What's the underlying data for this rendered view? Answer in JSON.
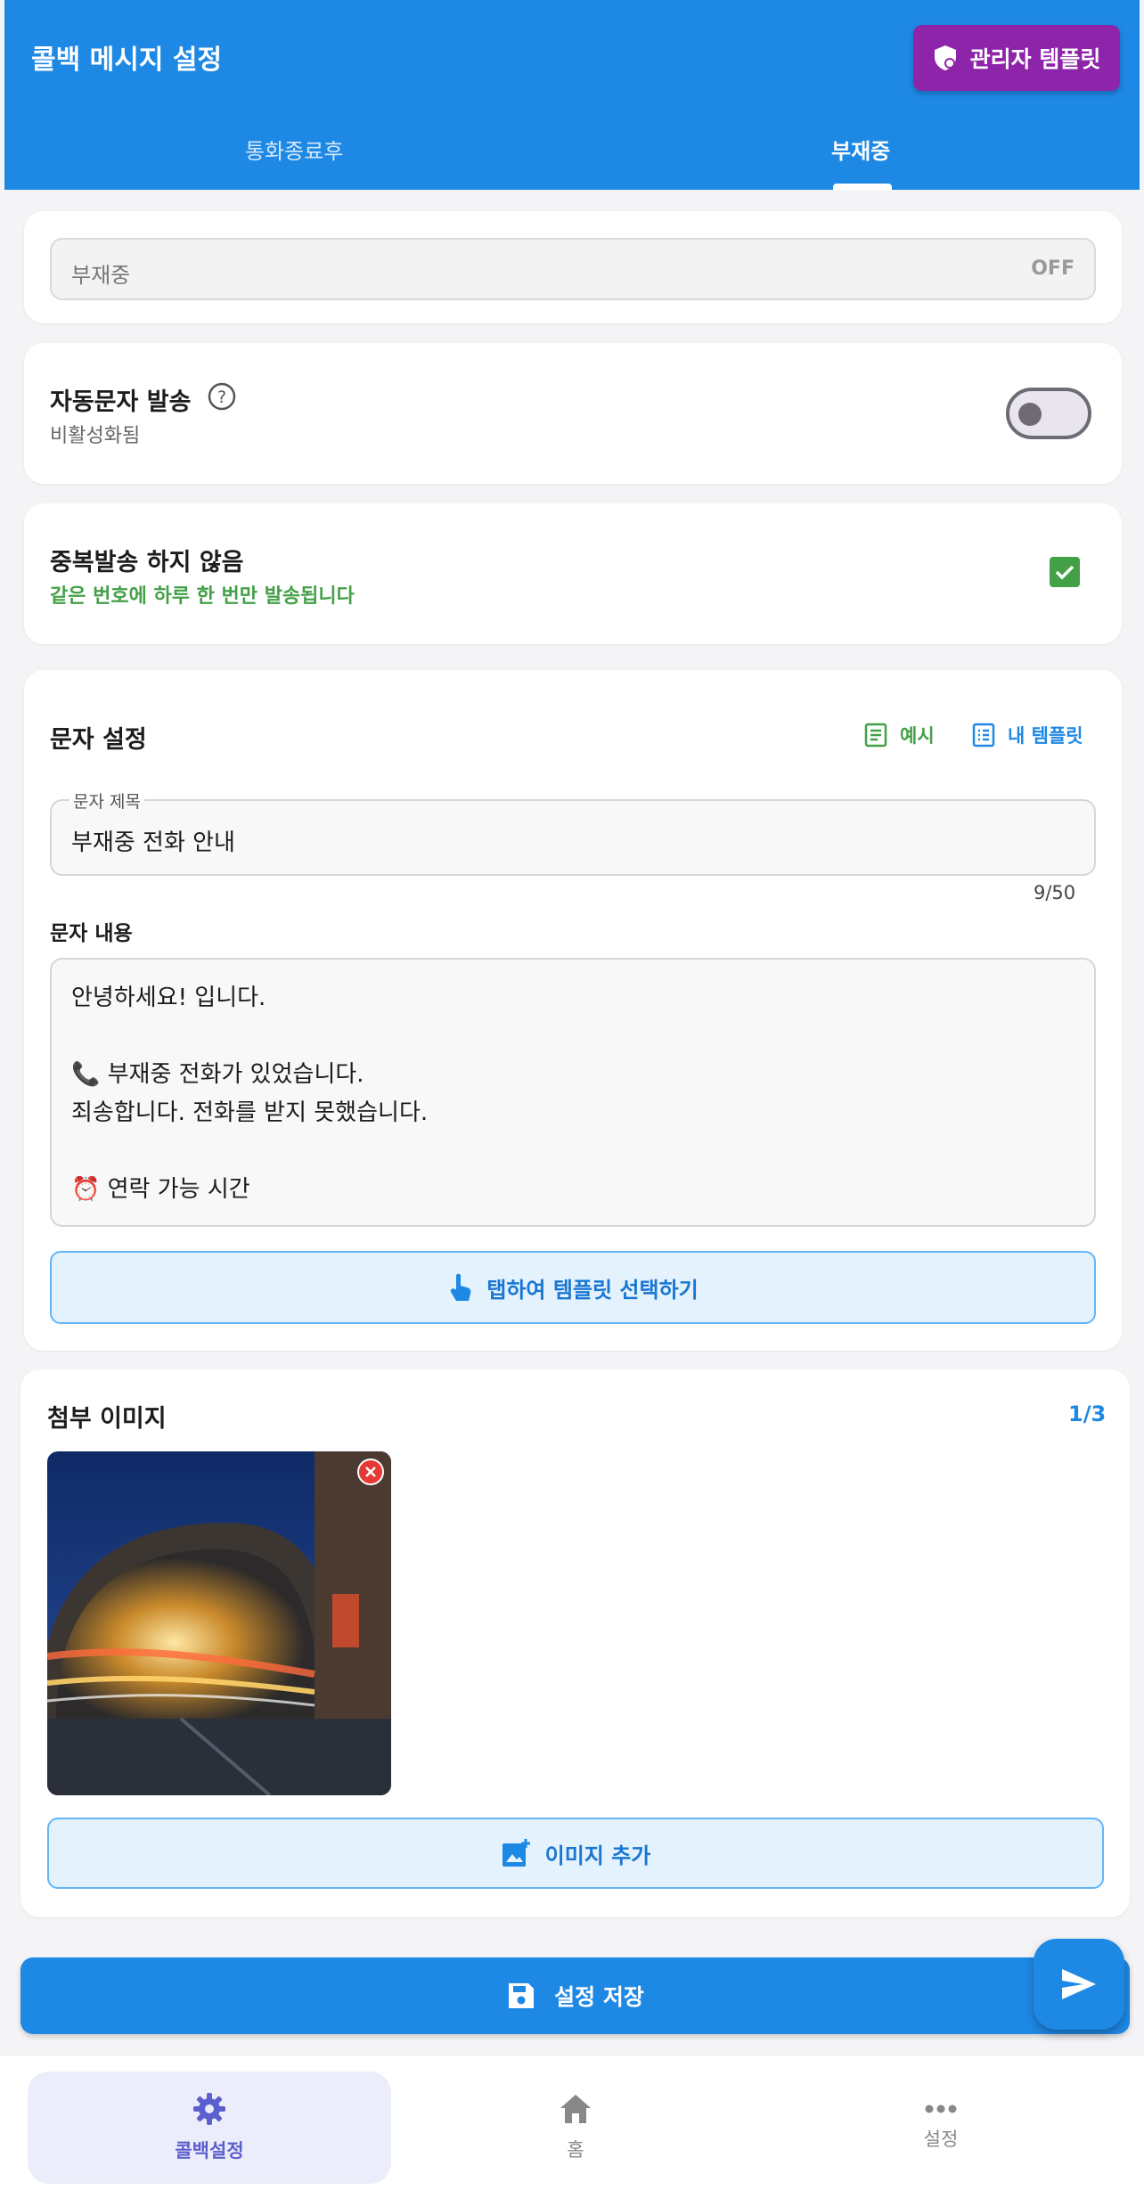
{
  "appbar": {
    "title": "콜백 메시지 설정",
    "admin_button": "관리자 템플릿"
  },
  "tabs": [
    {
      "label": "통화종료후",
      "active": false
    },
    {
      "label": "부재중",
      "active": true
    }
  ],
  "mode": {
    "label": "부재중",
    "state": "OFF"
  },
  "auto_send": {
    "title": "자동문자 발송",
    "status": "비활성화됨",
    "enabled": false
  },
  "no_duplicate": {
    "title": "중복발송 하지 않음",
    "description": "같은 번호에 하루 한 번만 발송됩니다",
    "checked": true
  },
  "message": {
    "section_title": "문자 설정",
    "example_label": "예시",
    "my_templates_label": "내 템플릿",
    "subject_label": "문자 제목",
    "subject_value": "부재중 전화 안내",
    "subject_counter": "9/50",
    "body_label": "문자 내용",
    "body_value": "안녕하세요! 입니다.\n\n📞 부재중 전화가 있었습니다.\n죄송합니다. 전화를 받지 못했습니다.\n\n⏰ 연락 가능 시간",
    "template_select_label": "탭하여 템플릿 선택하기"
  },
  "attachments": {
    "section_title": "첨부 이미지",
    "count": "1/3",
    "add_image_label": "이미지 추가"
  },
  "save_button": "설정 저장",
  "bottom_nav": [
    {
      "label": "콜백설정",
      "icon": "gear-icon",
      "active": true
    },
    {
      "label": "홈",
      "icon": "home-icon",
      "active": false
    },
    {
      "label": "설정",
      "icon": "more-icon",
      "active": false
    }
  ],
  "colors": {
    "primary": "#1e88e5",
    "admin": "#8e24aa",
    "success": "#43a047",
    "nav_active": "#5c5fcf"
  }
}
